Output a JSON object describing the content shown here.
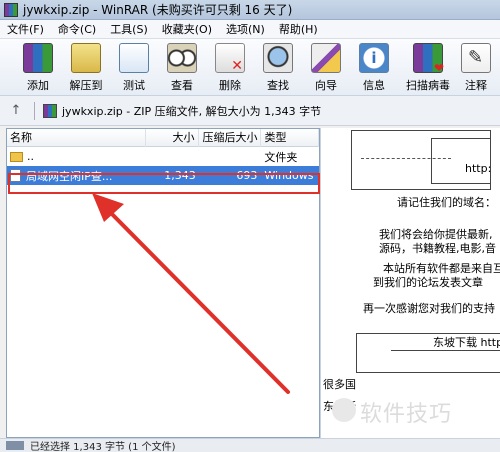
{
  "window": {
    "title": "jywkxip.zip - WinRAR (未购买许可只剩 16 天了)"
  },
  "menu": [
    "文件(F)",
    "命令(C)",
    "工具(S)",
    "收藏夹(O)",
    "选项(N)",
    "帮助(H)"
  ],
  "toolbar": [
    {
      "label": "添加",
      "icon": "add-archive-icon"
    },
    {
      "label": "解压到",
      "icon": "extract-to-icon"
    },
    {
      "label": "测试",
      "icon": "test-icon"
    },
    {
      "label": "查看",
      "icon": "view-icon"
    },
    {
      "label": "删除",
      "icon": "delete-icon"
    },
    {
      "label": "查找",
      "icon": "find-icon"
    },
    {
      "label": "向导",
      "icon": "wizard-icon"
    },
    {
      "label": "信息",
      "icon": "info-icon"
    },
    {
      "label": "扫描病毒",
      "icon": "virus-scan-icon"
    },
    {
      "label": "注释",
      "icon": "comment-icon"
    }
  ],
  "pathbar": {
    "text": "jywkxip.zip - ZIP 压缩文件, 解包大小为 1,343 字节"
  },
  "columns": {
    "name": "名称",
    "size": "大小",
    "packed": "压缩后大小",
    "type": "类型"
  },
  "files": [
    {
      "name": "..",
      "size": "",
      "packed": "",
      "type": "文件夹",
      "kind": "folder"
    },
    {
      "name": "局域网空闲IP查...",
      "size": "1,343",
      "packed": "693",
      "type": "Windows",
      "kind": "file"
    }
  ],
  "comment": {
    "lines": [
      "http:",
      "请记住我们的域名：",
      "我们将会给你提供最新,",
      "源码，书籍教程,电影,音",
      "本站所有软件都是来自互",
      "到我们的论坛发表文章",
      "再一次感谢您对我们的支持",
      "东坡下载  http",
      "很多国",
      "东坡所"
    ]
  },
  "watermark": "软件技巧",
  "status": {
    "text": "已经选择 1,343 字节 (1 个文件)"
  },
  "colors": {
    "selection": "#3b7dd8",
    "annotation_red": "#e0302a"
  }
}
